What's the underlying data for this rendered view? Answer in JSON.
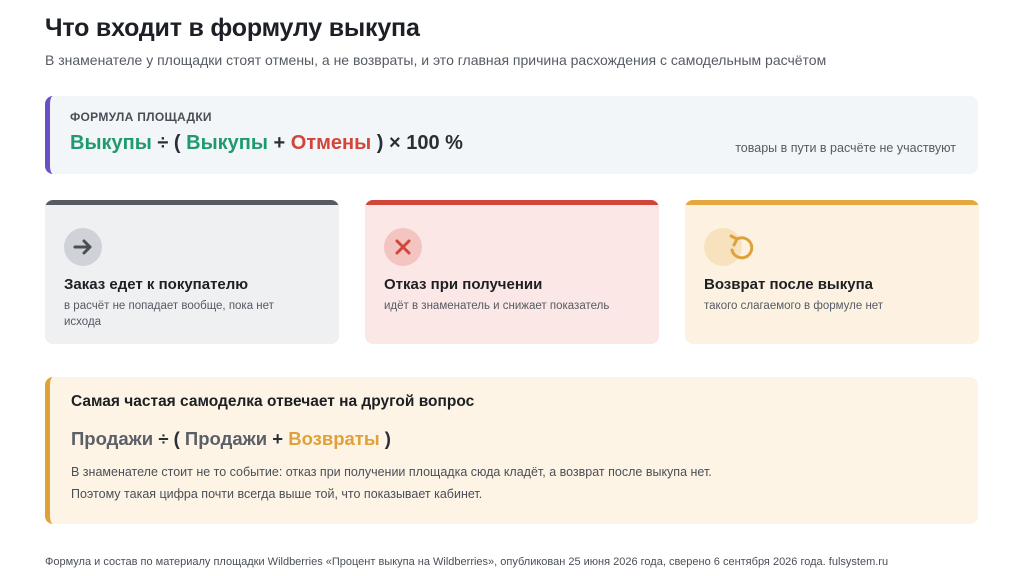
{
  "header": {
    "title": "Что входит в формулу выкупа",
    "subtitle": "В знаменателе у площадки стоят отмены, а не возвраты, и это главная причина расхождения с самодельным расчётом"
  },
  "platform_formula": {
    "label": "ФОРМУЛА ПЛОЩАДКИ",
    "term_buyouts": "Выкупы",
    "op_div_open": " ÷ ( ",
    "term_buyouts_2": "Выкупы",
    "op_plus": " + ",
    "term_cancellations": "Отмены",
    "op_close": " ) × 100 %",
    "note": "товары в пути в расчёте не участвуют"
  },
  "cards": [
    {
      "icon": "arrow-right-icon",
      "title": "Заказ едет к покупателю",
      "desc": "в расчёт не попадает вообще, пока нет исхода",
      "accent": "#555b63"
    },
    {
      "icon": "x-icon",
      "title": "Отказ при получении",
      "desc": "идёт в знаменатель и снижает показатель",
      "accent": "#d1453b"
    },
    {
      "icon": "return-arrow-icon",
      "title": "Возврат после выкупа",
      "desc": "такого слагаемого в формуле нет",
      "accent": "#e5a740"
    }
  ],
  "homemade": {
    "title": "Самая частая самоделка отвечает на другой вопрос",
    "term_sales": "Продажи",
    "op_div_open": " ÷ ( ",
    "term_sales_2": "Продажи",
    "op_plus": " + ",
    "term_returns": "Возвраты",
    "op_close": " )",
    "text_1": "В знаменателе стоит не то событие: отказ при получении площадка сюда кладёт, а возврат после выкупа нет.",
    "text_2": "Поэтому такая цифра почти всегда выше той, что показывает кабинет."
  },
  "footer": "Формула и состав по материалу площадки Wildberries «Процент выкупа на Wildberries», опубликован 25 июня 2026 года, сверено 6 сентября 2026 года. fulsystem.ru",
  "colors": {
    "purple_accent": "#6a4fc7",
    "green": "#1f9a6e",
    "red": "#d1453b",
    "amber": "#e0a13a",
    "gray": "#555b63"
  }
}
